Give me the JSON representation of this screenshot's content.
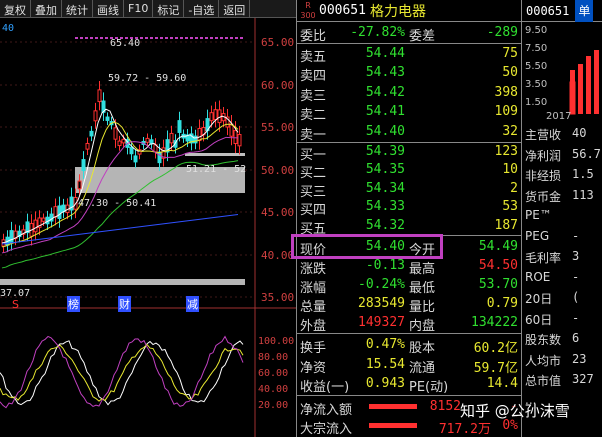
{
  "toolbar": {
    "buttons": [
      "复权",
      "叠加",
      "统计",
      "画线",
      "F10",
      "标记",
      "-自选",
      "返回"
    ]
  },
  "chart": {
    "top_left_label": "40",
    "price_axis": [
      "65.00",
      "60.00",
      "55.00",
      "50.00",
      "45.00",
      "40.00",
      "35.00"
    ],
    "indicator_axis": [
      "100.00",
      "80.00",
      "60.00",
      "40.00",
      "20.00"
    ],
    "annotations": {
      "high": "65.40",
      "range1": "59.72 - 59.60",
      "range2": "51.21 - 52",
      "range3": "47.30 - 50.41",
      "low": "37.07"
    },
    "markers": {
      "s": "S",
      "bang": "榜",
      "cai": "财",
      "jian": "减"
    }
  },
  "quote": {
    "rank_label": "R\n300",
    "code": "000651",
    "name": "格力电器",
    "ratio": {
      "label": "委比",
      "value": "-27.82%",
      "label2": "委差",
      "value2": "-289"
    },
    "asks": [
      {
        "label": "卖五",
        "price": "54.44",
        "vol": "75"
      },
      {
        "label": "卖四",
        "price": "54.43",
        "vol": "50"
      },
      {
        "label": "卖三",
        "price": "54.42",
        "vol": "398"
      },
      {
        "label": "卖二",
        "price": "54.41",
        "vol": "109"
      },
      {
        "label": "卖一",
        "price": "54.40",
        "vol": "32"
      }
    ],
    "bids": [
      {
        "label": "买一",
        "price": "54.39",
        "vol": "123"
      },
      {
        "label": "买二",
        "price": "54.35",
        "vol": "10"
      },
      {
        "label": "买三",
        "price": "54.34",
        "vol": "2"
      },
      {
        "label": "买四",
        "price": "54.33",
        "vol": "53"
      },
      {
        "label": "买五",
        "price": "54.32",
        "vol": "187"
      }
    ],
    "stats": [
      {
        "l1": "现价",
        "v1": "54.40",
        "l2": "今开",
        "v2": "54.49"
      },
      {
        "l1": "涨跌",
        "v1": "-0.13",
        "l2": "最高",
        "v2": "54.50"
      },
      {
        "l1": "涨幅",
        "v1": "-0.24%",
        "l2": "最低",
        "v2": "53.70"
      },
      {
        "l1": "总量",
        "v1": "283549",
        "l2": "量比",
        "v2": "0.79"
      },
      {
        "l1": "外盘",
        "v1": "149327",
        "l2": "内盘",
        "v2": "134222"
      }
    ],
    "fundamentals": [
      {
        "l1": "换手",
        "v1": "0.47%",
        "l2": "股本",
        "v2": "60.2亿"
      },
      {
        "l1": "净资",
        "v1": "15.54",
        "l2": "流通",
        "v2": "59.7亿"
      },
      {
        "l1": "收益(一)",
        "v1": "0.943",
        "l2": "PE(动)",
        "v2": "14.4"
      }
    ],
    "flows": [
      {
        "label": "净流入额",
        "value": "8152",
        "pct": "-"
      },
      {
        "label": "大宗流入",
        "value": "717.2万",
        "pct": "0%"
      }
    ]
  },
  "right_panel": {
    "code": "000651",
    "tab": "单",
    "axis": [
      "9.50",
      "7.50",
      "5.50",
      "3.50",
      "1.50"
    ],
    "year": "2017",
    "rows": [
      {
        "label": "主营收",
        "value": "40"
      },
      {
        "label": "净利润",
        "value": "56.7"
      },
      {
        "label": "非经损",
        "value": "1.5"
      },
      {
        "label": "货币金",
        "value": "113"
      },
      {
        "label": "PE™",
        "value": ""
      },
      {
        "label": "PEG",
        "value": "-"
      },
      {
        "label": "毛利率",
        "value": "3"
      },
      {
        "label": "ROE",
        "value": "-"
      },
      {
        "label": "20日",
        "value": "("
      },
      {
        "label": "60日",
        "value": "-"
      },
      {
        "label": "股东数",
        "value": "6"
      },
      {
        "label": "人均市",
        "value": "23"
      },
      {
        "label": "总市值",
        "value": "327"
      },
      {
        "label": "...",
        "value": ""
      }
    ]
  },
  "watermark": "知乎 @公孙沫雪",
  "colors": {
    "up": "#ff3030",
    "down": "#30e030",
    "highlight": "#c040c0",
    "ma_yellow": "#e8e830",
    "ma_white": "#ffffff",
    "ma_green": "#30c030",
    "ma_blue": "#3050ff"
  }
}
